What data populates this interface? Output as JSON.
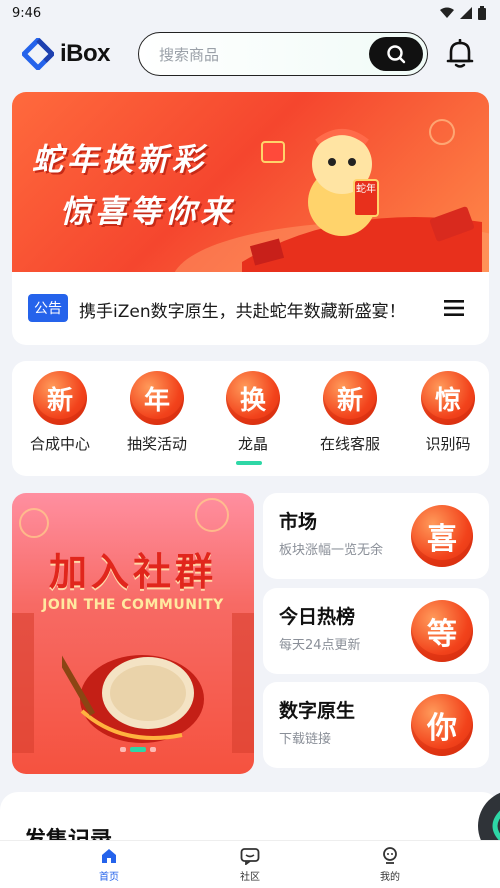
{
  "status_bar": {
    "time": "9:46"
  },
  "header": {
    "logo_text": "iBox",
    "search_placeholder": "搜索商品"
  },
  "banner": {
    "line1": "蛇年换新彩",
    "line2": "惊喜等你来",
    "mascot_sign": "蛇年"
  },
  "notice": {
    "tag": "公告",
    "text": "携手iZen数字原生，共赴蛇年数藏新盛宴！"
  },
  "quick_menu": [
    {
      "glyph": "新",
      "label": "合成中心"
    },
    {
      "glyph": "年",
      "label": "抽奖活动"
    },
    {
      "glyph": "换",
      "label": "龙晶"
    },
    {
      "glyph": "新",
      "label": "在线客服"
    },
    {
      "glyph": "惊",
      "label": "识别码"
    }
  ],
  "community_banner": {
    "title": "加入社群",
    "subtitle": "JOIN THE COMMUNITY"
  },
  "side_cards": [
    {
      "title": "市场",
      "subtitle": "板块涨幅一览无余",
      "badge": "喜"
    },
    {
      "title": "今日热榜",
      "subtitle": "每天24点更新",
      "badge": "等"
    },
    {
      "title": "数字原生",
      "subtitle": "下载链接",
      "badge": "你"
    }
  ],
  "section": {
    "title": "发售记录"
  },
  "tabbar": [
    {
      "label": "首页",
      "icon": "home-icon",
      "active": true
    },
    {
      "label": "社区",
      "icon": "community-icon",
      "active": false
    },
    {
      "label": "我的",
      "icon": "profile-icon",
      "active": false
    }
  ],
  "colors": {
    "accent_blue": "#2563eb",
    "festive_red": "#f2421b",
    "indicator_green": "#2ed7a6"
  }
}
